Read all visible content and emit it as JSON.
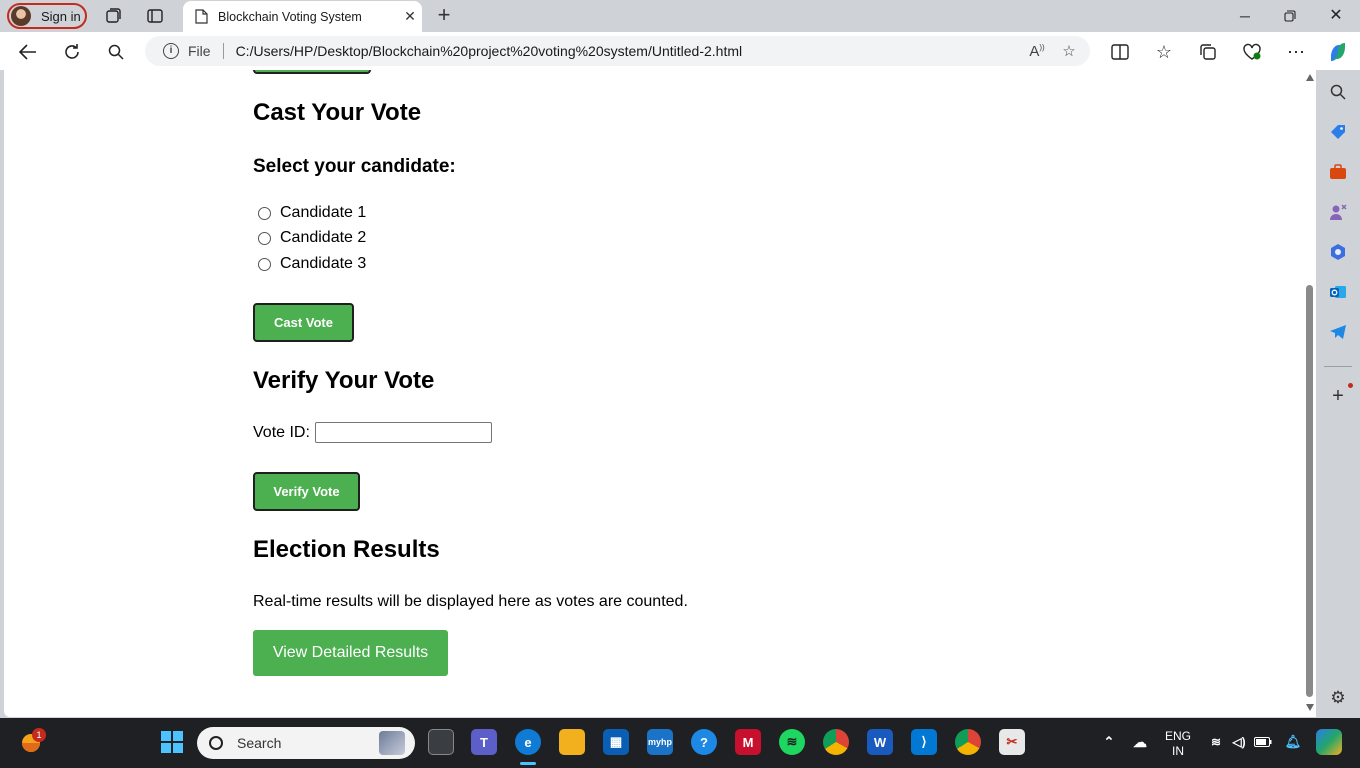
{
  "browser": {
    "signin_label": "Sign in",
    "tab_title": "Blockchain Voting System",
    "url_scheme_label": "File",
    "url": "C:/Users/HP/Desktop/Blockchain%20project%20voting%20system/Untitled-2.html"
  },
  "page": {
    "cast_heading": "Cast Your Vote",
    "select_heading": "Select your candidate:",
    "candidates": [
      "Candidate 1",
      "Candidate 2",
      "Candidate 3"
    ],
    "cast_button": "Cast Vote",
    "verify_heading": "Verify Your Vote",
    "vote_id_label": "Vote ID:",
    "vote_id_value": "",
    "verify_button": "Verify Vote",
    "results_heading": "Election Results",
    "results_text": "Real-time results will be displayed here as votes are counted.",
    "results_button": "View Detailed Results"
  },
  "taskbar": {
    "search_label": "Search",
    "notification_count": "1",
    "lang_line1": "ENG",
    "lang_line2": "IN"
  },
  "colors": {
    "accent_green": "#4caf50",
    "signin_border": "#c42b1c"
  }
}
